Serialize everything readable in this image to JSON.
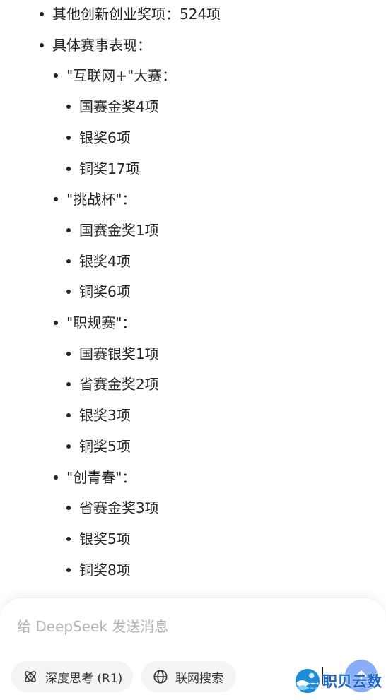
{
  "message": {
    "items": [
      {
        "level": 1,
        "text": "其他创新创业奖项：524项"
      },
      {
        "level": 1,
        "text": "具体赛事表现："
      },
      {
        "level": 2,
        "text": "\"互联网+\"大赛："
      },
      {
        "level": 3,
        "text": "国赛金奖4项"
      },
      {
        "level": 3,
        "text": "银奖6项"
      },
      {
        "level": 3,
        "text": "铜奖17项"
      },
      {
        "level": 2,
        "text": "\"挑战杯\"："
      },
      {
        "level": 3,
        "text": "国赛金奖1项"
      },
      {
        "level": 3,
        "text": "银奖4项"
      },
      {
        "level": 3,
        "text": "铜奖6项"
      },
      {
        "level": 2,
        "text": "\"职规赛\"："
      },
      {
        "level": 3,
        "text": "国赛银奖1项"
      },
      {
        "level": 3,
        "text": "省赛金奖2项"
      },
      {
        "level": 3,
        "text": "银奖3项"
      },
      {
        "level": 3,
        "text": "铜奖5项"
      },
      {
        "level": 2,
        "text": "\"创青春\"："
      },
      {
        "level": 3,
        "text": "省赛金奖3项"
      },
      {
        "level": 3,
        "text": "银奖5项"
      },
      {
        "level": 3,
        "text": "铜奖8项"
      }
    ]
  },
  "composer": {
    "placeholder": "给 DeepSeek 发送消息",
    "value": "",
    "deep_think_label": "深度思考 (R1)",
    "deep_think_icon": "atom-icon",
    "web_search_label": "联网搜索",
    "web_search_icon": "globe-icon",
    "send_icon": "arrow-up-icon",
    "send_color": "#8aaef5"
  },
  "watermark": {
    "text": "职贝云数"
  }
}
